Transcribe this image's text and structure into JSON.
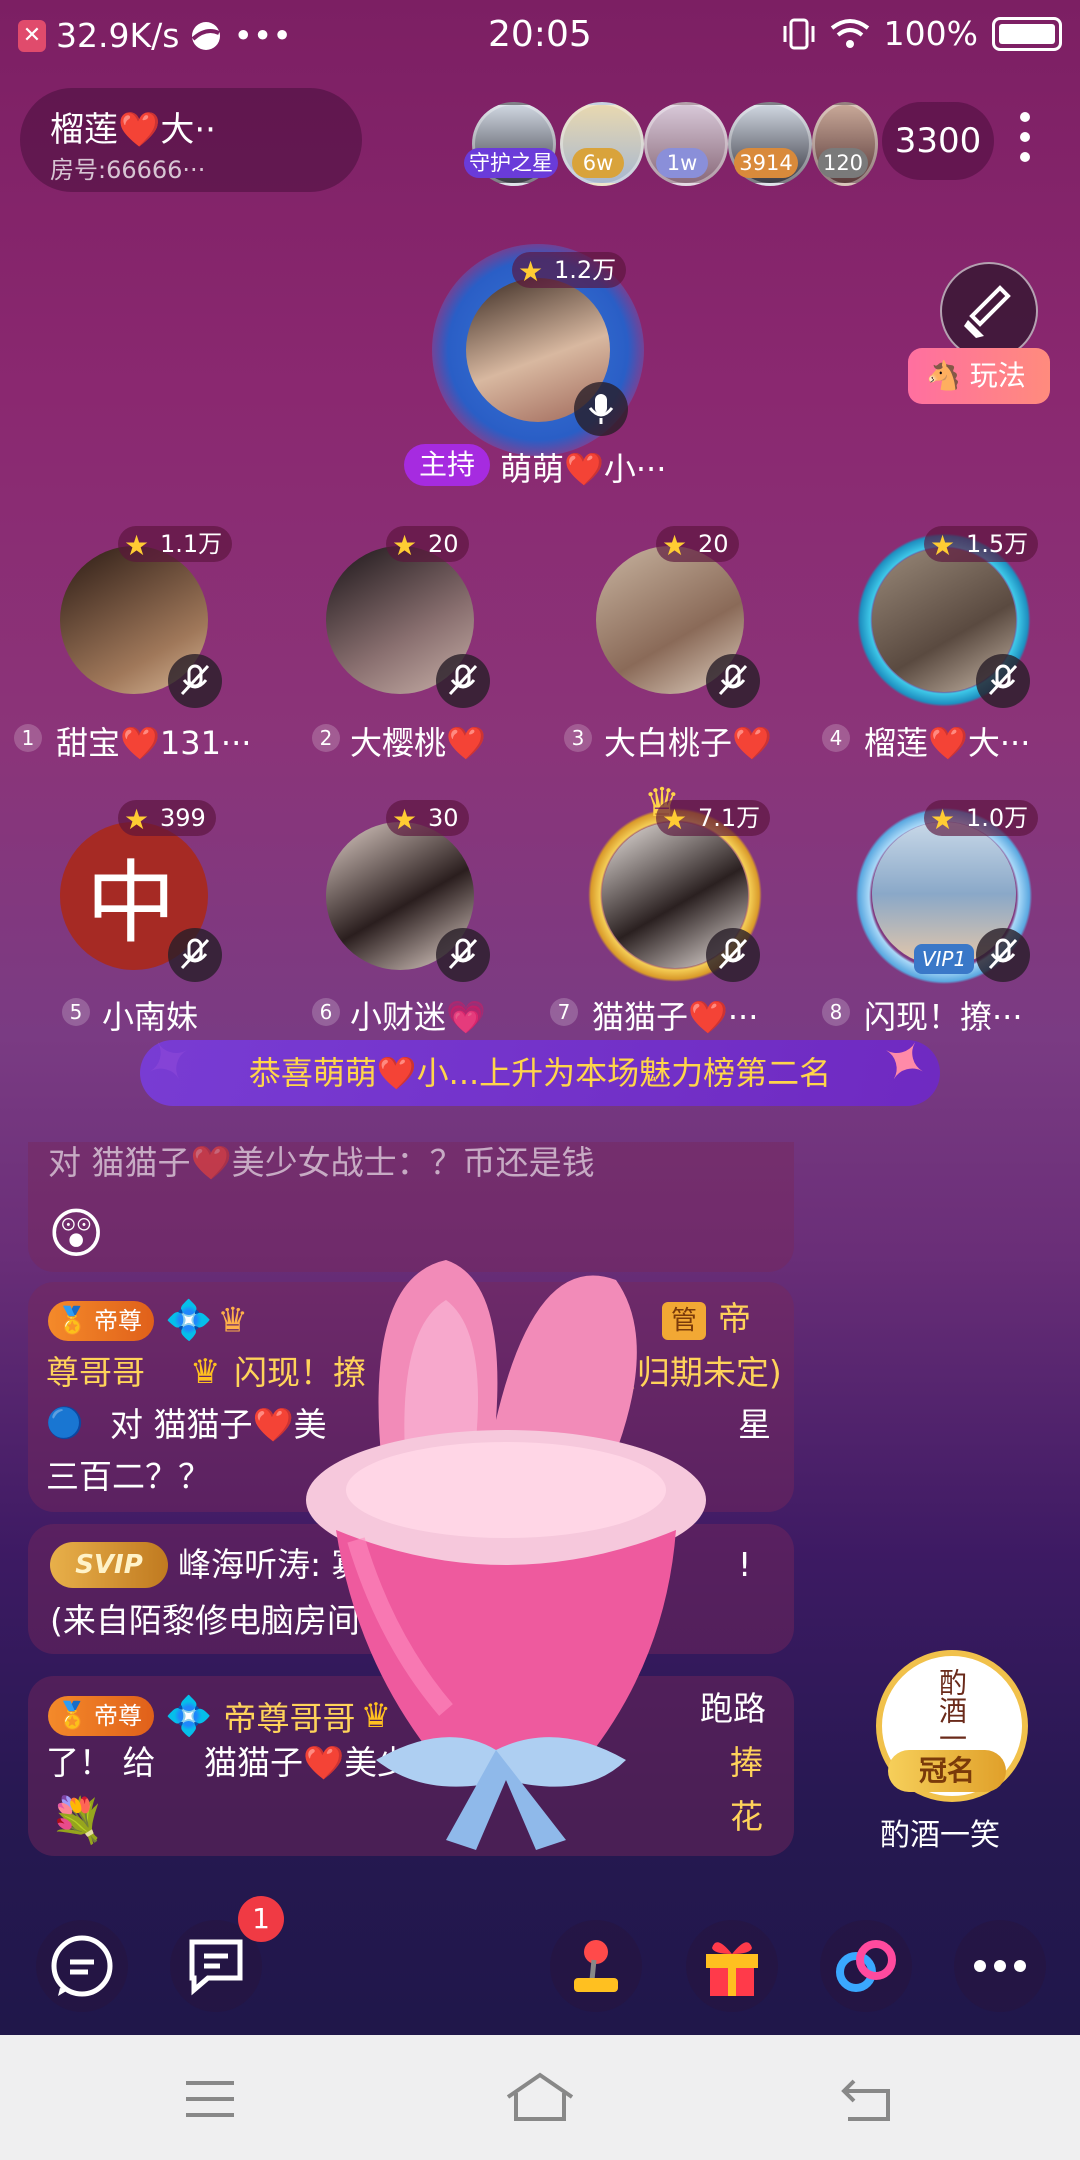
{
  "status_bar": {
    "speed": "32.9K/s",
    "dots": "•••",
    "time": "20:05",
    "battery": "100%"
  },
  "room": {
    "name": "榴莲❤️大··",
    "id": "房号:66666···"
  },
  "top_audience": [
    {
      "tag": "守护之星",
      "tag_color": "#6a3bd9"
    },
    {
      "tag": "6w",
      "tag_color": "#d9a33b"
    },
    {
      "tag": "1w",
      "tag_color": "#8a8fd9"
    },
    {
      "tag": "3914",
      "tag_color": "#d98a3b"
    },
    {
      "tag": "120",
      "tag_color": "#7a7a7a"
    }
  ],
  "online_count": "3300",
  "side": {
    "wanfa": "玩法"
  },
  "host": {
    "score": "1.2万",
    "role": "主持",
    "name": "萌萌❤️小···"
  },
  "seats": [
    {
      "num": "1",
      "score": "1.1万",
      "name": "甜宝❤️131···",
      "bg": "#6a4a3a"
    },
    {
      "num": "2",
      "score": "20",
      "name": "大樱桃❤️",
      "bg": "#4a3a44"
    },
    {
      "num": "3",
      "score": "20",
      "name": "大白桃子❤️",
      "bg": "#a89080"
    },
    {
      "num": "4",
      "score": "1.5万",
      "name": "榴莲❤️大···",
      "bg": "#8a7a6a"
    },
    {
      "num": "5",
      "score": "399",
      "name": "小南妹",
      "bg": "#a62a24"
    },
    {
      "num": "6",
      "score": "30",
      "name": "小财迷💗",
      "bg": "#c9b8b0"
    },
    {
      "num": "7",
      "score": "7.1万",
      "name": "猫猫子❤️···",
      "bg": "#e6e0dc"
    },
    {
      "num": "8",
      "score": "1.0万",
      "name": "闪现！撩···",
      "bg": "#8aa8c8"
    }
  ],
  "banner": "恭喜萌萌❤️小...上升为本场魅力榜第二名",
  "chat": {
    "msg0_line": "对 猫猫子❤️美少女战士：？币还是钱",
    "msg1_badge": "帝尊",
    "msg1_guan": "管",
    "msg1_l1": "帝",
    "msg1_l2a": "尊哥哥",
    "msg1_l2b": "闪现！撩",
    "msg1_l2c": "(归期未定)",
    "msg1_l3a": "对 猫猫子❤️美",
    "msg1_l3b": "星",
    "msg1_l4": "三百二？？",
    "msg2_vip": "SVIP",
    "msg2_l1": "峰海听涛: 寡",
    "msg2_l1b": "!",
    "msg2_l2": "(来自陌黎修电脑房间",
    "msg3_badge": "帝尊",
    "msg3_name": "帝尊哥哥",
    "msg3_l1b": "跑路",
    "msg3_l2a": "了！ 给",
    "msg3_l2b": "猫猫子❤️美少",
    "msg3_l2c": "捧花"
  },
  "crown": {
    "label": "冠名",
    "name": "酌酒一笑",
    "inner": "酌酒一"
  },
  "unread_count": "1"
}
